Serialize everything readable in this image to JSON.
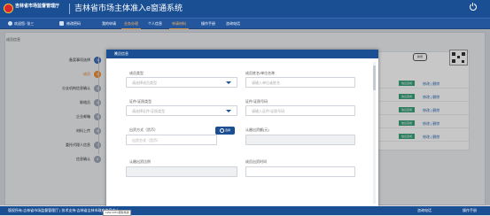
{
  "header": {
    "agency": "吉林省市场监督管理厅",
    "system_title": "吉林省市场主体准入e窗通系统"
  },
  "navbar": {
    "welcome": "欢迎您: 张三",
    "change_password": "修改密码",
    "items": [
      {
        "label": "我的申请"
      },
      {
        "label": "业务办理"
      },
      {
        "label": "个人信息"
      },
      {
        "label": "申请材料"
      },
      {
        "label": "操作手册"
      },
      {
        "label": "咨询电话"
      }
    ]
  },
  "content": {
    "title": "成员信息",
    "steps": [
      {
        "label": "备案事项选择",
        "num": "1",
        "state": "done"
      },
      {
        "label": "成员",
        "num": "2",
        "state": "active"
      },
      {
        "label": "分支机构信息确认",
        "num": "3",
        "state": "pending"
      },
      {
        "label": "联络员",
        "num": "4",
        "state": "pending"
      },
      {
        "label": "企业邮箱",
        "num": "5",
        "state": "pending"
      },
      {
        "label": "材料上传",
        "num": "6",
        "state": "pending"
      },
      {
        "label": "委托代理人信息",
        "num": "7",
        "state": "pending"
      },
      {
        "label": "信息确认",
        "num": "8",
        "state": "pending"
      }
    ],
    "add_button": "新增",
    "rows": [
      {
        "status": "信息完成",
        "ops": "修改 | 删除"
      },
      {
        "status": "信息完成",
        "ops": "修改 | 删除"
      },
      {
        "status": "信息完成",
        "ops": "修改 | 删除"
      },
      {
        "status": "信息完成",
        "ops": "修改 | 删除"
      },
      {
        "status": "信息完成",
        "ops": "修改 | 删除"
      }
    ]
  },
  "modal": {
    "title": "成员信息",
    "close": "×",
    "fields": {
      "member_type_label": "成员类型",
      "member_type_placeholder": "请选择成员类型",
      "member_name_label": "成员姓名/单位名称",
      "member_name_placeholder": "请输入单位或姓名",
      "cert_type_label": "证件/证照类型",
      "cert_type_placeholder": "请选择证件/证照类型",
      "cert_no_label": "证件/证照号码",
      "cert_no_placeholder": "请输入证件/证照号码",
      "contribution_label": "出资方式（货币）",
      "contribution_placeholder": "出资方式（货币）",
      "select_button": "选择",
      "subscribed_amount_label": "认缴出资额(元)",
      "subscribed_ratio_label": "认缴出资比例",
      "contribution_time_label": "成员出资时间"
    }
  },
  "footer": {
    "copyright": "版权所有:吉林省市场监督管理厅 | 技术支持:吉林省吉林市政府信息中心",
    "tip": "1152 CPN 服务热线",
    "consult": "咨询电话",
    "manual": "操作手册"
  }
}
